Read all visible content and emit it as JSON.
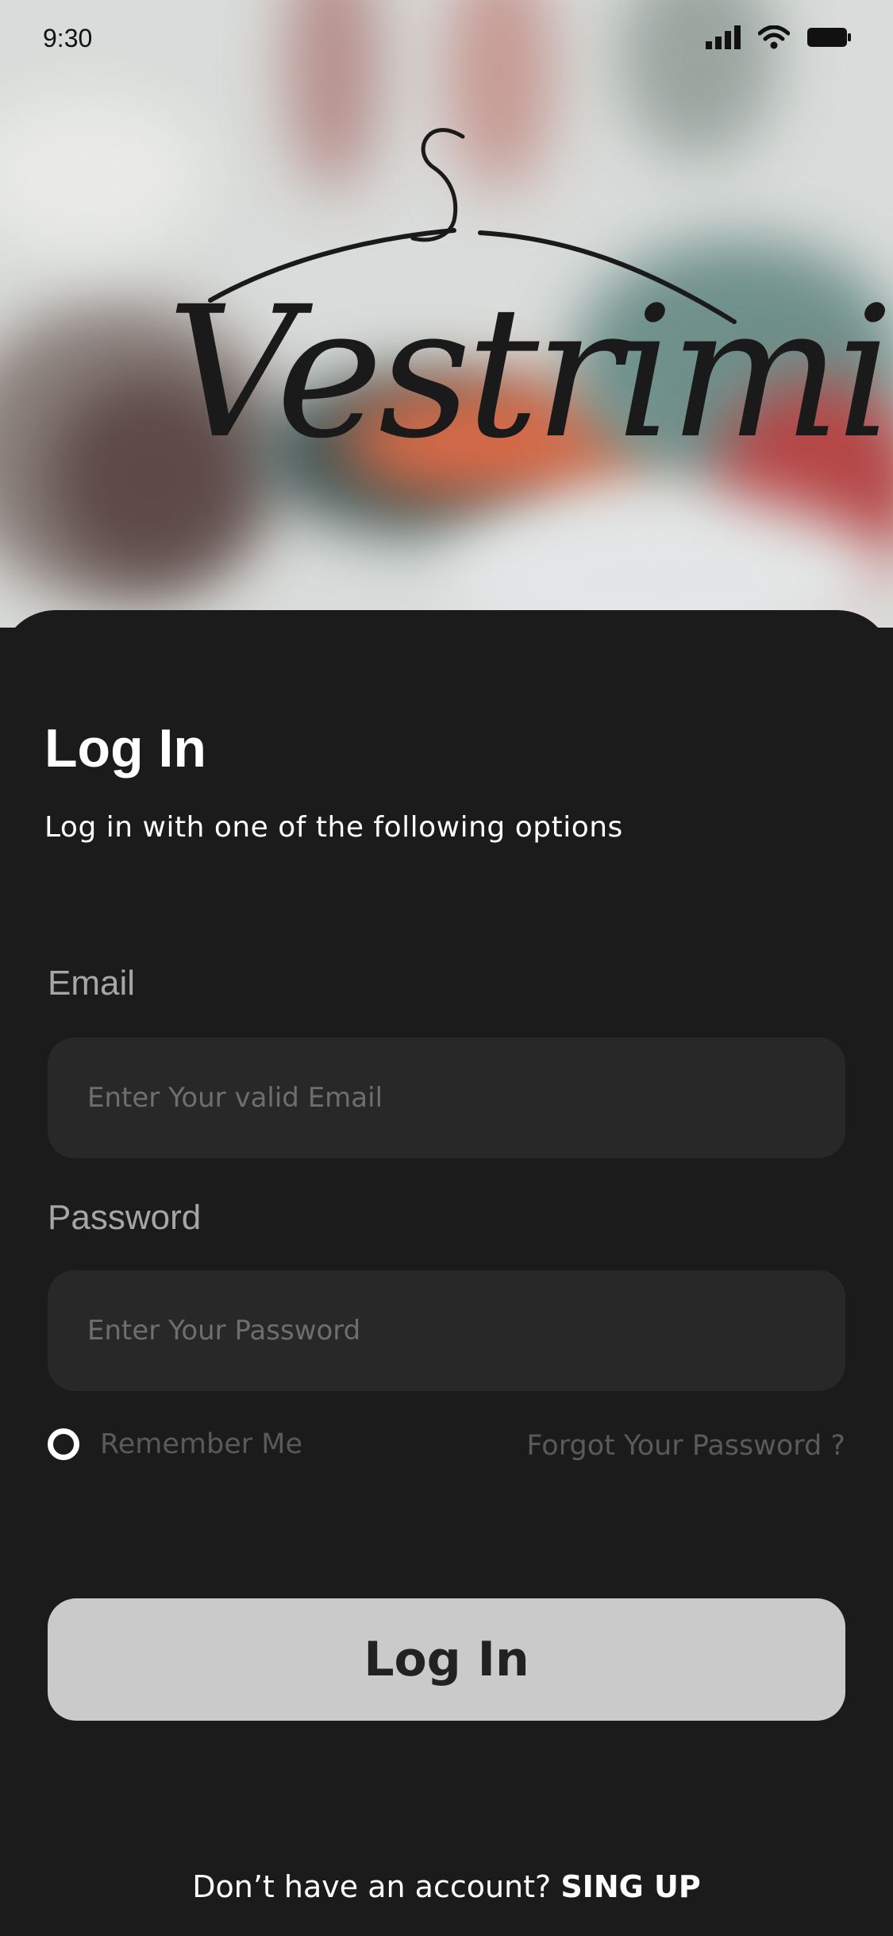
{
  "status_bar": {
    "time": "9:30"
  },
  "brand": {
    "logo_text": "Vestrimi"
  },
  "login": {
    "title": "Log In",
    "subtitle": "Log in with one of the following options",
    "email_label": "Email",
    "email_placeholder": "Enter Your valid Email",
    "email_value": "",
    "password_label": "Password",
    "password_placeholder": "Enter Your Password",
    "password_value": "",
    "remember_label": "Remember Me",
    "forgot_label": "Forgot Your Password ?",
    "submit_label": "Log In",
    "signup_prompt": "Don’t have an account?",
    "signup_link": "SING UP"
  },
  "icons": {
    "signal": "cellular-signal-icon",
    "wifi": "wifi-icon",
    "battery": "battery-icon",
    "logo": "hanger-icon",
    "remember": "radio-icon"
  },
  "colors": {
    "sheet_bg": "#1b1b1b",
    "input_bg": "#282828",
    "button_bg": "#cbcacb",
    "muted_text": "#5a5a5a",
    "label_text": "#a6a6a6"
  }
}
